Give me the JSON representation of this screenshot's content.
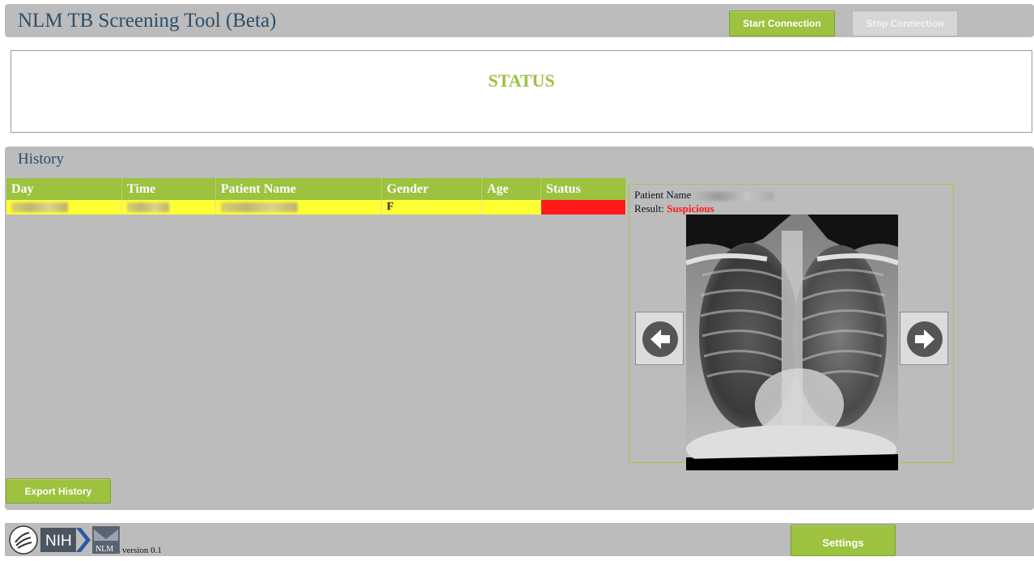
{
  "header": {
    "title": "NLM TB Screening Tool (Beta)",
    "start_label": "Start Connection",
    "stop_label": "Stop Connection"
  },
  "status": {
    "label": "STATUS"
  },
  "history": {
    "title": "History",
    "columns": [
      "Day",
      "Time",
      "Patient Name",
      "Gender",
      "Age",
      "Status"
    ],
    "rows": [
      {
        "gender": "F",
        "age": "",
        "status_color": "#ff1a1a",
        "highlight_color": "#ffff33"
      }
    ],
    "export_label": "Export History"
  },
  "viewer": {
    "patient_name_label": "Patient Name",
    "result_label": "Result:",
    "result_value": "Suspicious",
    "result_color": "#ff1a1a",
    "prev_icon": "arrow-left-icon",
    "next_icon": "arrow-right-icon"
  },
  "footer": {
    "version": "version 0.1",
    "settings_label": "Settings",
    "logos": [
      "hhs-logo",
      "nih-logo",
      "nlm-logo"
    ],
    "nih_text": "NIH",
    "nlm_text": "NLM"
  },
  "colors": {
    "accent": "#9cc23f",
    "panel": "#bcbcbc",
    "title": "#2c4d6b"
  }
}
